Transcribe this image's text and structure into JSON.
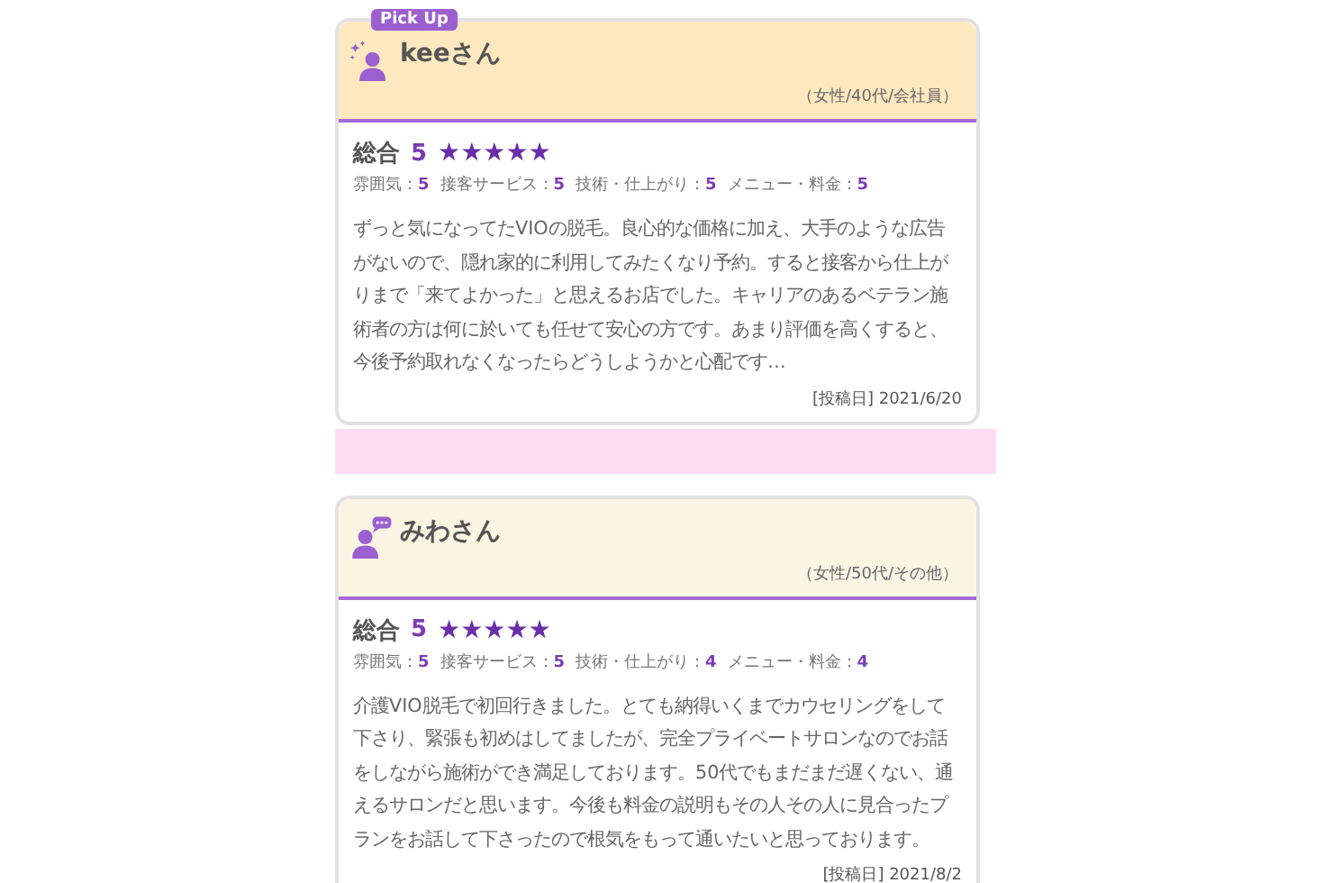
{
  "reviews": [
    {
      "badge": "Pick Up",
      "pickup": true,
      "name": "keeさん",
      "profile": "（女性/40代/会社員）",
      "overall_label": "総合",
      "overall": "5",
      "stars": 5,
      "ratings": [
        {
          "label": "雰囲気：",
          "value": "5"
        },
        {
          "label": "接客サービス：",
          "value": "5"
        },
        {
          "label": "技術・仕上がり：",
          "value": "5"
        },
        {
          "label": "メニュー・料金：",
          "value": "5"
        }
      ],
      "text": "ずっと気になってたVIOの脱毛。良心的な価格に加え、大手のような広告がないので、隠れ家的に利用してみたくなり予約。すると接客から仕上がりまで「来てよかった」と思えるお店でした。キャリアのあるベテラン施術者の方は何に於いても任せて安心の方です。あまり評価を高くすると、今後予約取れなくなったらどうしようかと心配です…",
      "date": "[投稿日] 2021/6/20"
    },
    {
      "pickup": false,
      "name": "みわさん",
      "profile": "（女性/50代/その他）",
      "overall_label": "総合",
      "overall": "5",
      "stars": 5,
      "ratings": [
        {
          "label": "雰囲気：",
          "value": "5"
        },
        {
          "label": "接客サービス：",
          "value": "5"
        },
        {
          "label": "技術・仕上がり：",
          "value": "4"
        },
        {
          "label": "メニュー・料金：",
          "value": "4"
        }
      ],
      "text": "介護VIO脱毛で初回行きました。とても納得いくまでカウセリングをして下さり、緊張も初めはしてましたが、完全プライベートサロンなのでお話をしながら施術ができ満足しております。50代でもまだまだ遅くない、通えるサロンだと思います。今後も料金の説明もその人その人に見合ったプランをお話して下さったので根気をもって通いたいと思っております。",
      "date": "[投稿日] 2021/8/2"
    }
  ]
}
